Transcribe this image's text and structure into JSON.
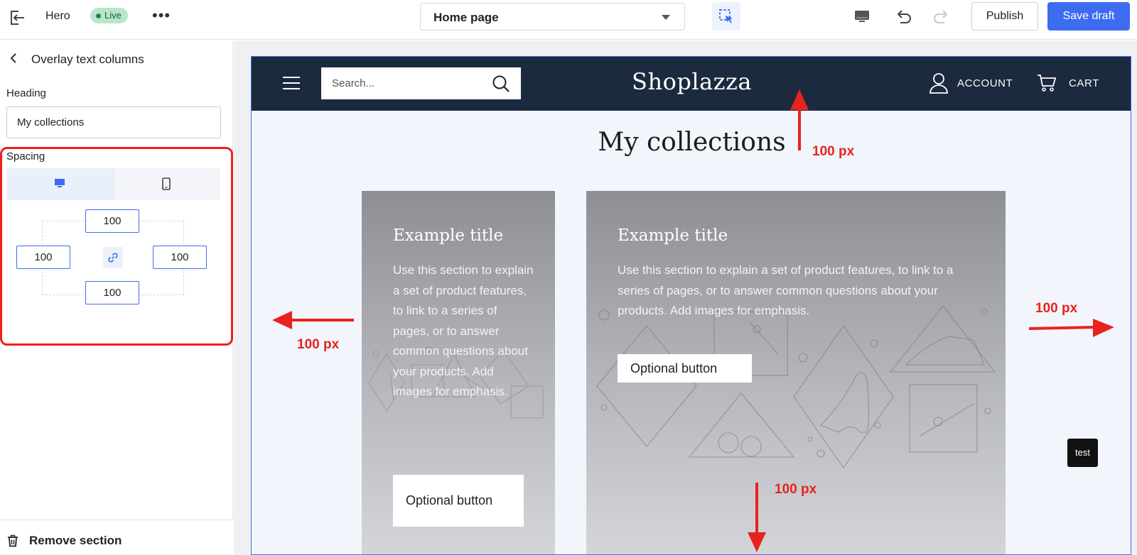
{
  "topbar": {
    "section_title": "Hero",
    "live_badge": "Live",
    "more": "•••",
    "page_select": "Home page",
    "publish": "Publish",
    "save_draft": "Save draft"
  },
  "sidebar": {
    "title": "Overlay text columns",
    "heading_label": "Heading",
    "heading_value": "My collections",
    "spacing_label": "Spacing",
    "spacing": {
      "top": "100",
      "left": "100",
      "right": "100",
      "bottom": "100"
    },
    "remove_section": "Remove section"
  },
  "store": {
    "search_placeholder": "Search...",
    "logo": "Shoplazza",
    "account": "ACCOUNT",
    "cart": "CART",
    "heading": "My collections"
  },
  "cards": [
    {
      "title": "Example title",
      "text": "Use this section to explain a set of product features, to link to a series of pages, or to answer common questions about your products. Add images for emphasis.",
      "button": "Optional button"
    },
    {
      "title": "Example title",
      "text": "Use this section to explain a set of product features, to link to a series of pages, or to answer common questions about your products. Add images for emphasis.",
      "button": "Optional button"
    }
  ],
  "badge": "test",
  "annotations": {
    "top": "100 px",
    "left": "100 px",
    "right": "100 px",
    "bottom": "100 px"
  },
  "colors": {
    "accent": "#3d6cf0",
    "header_bg": "#1c2a40",
    "annotation": "#e8231b",
    "live_bg": "#b8e6c8"
  }
}
